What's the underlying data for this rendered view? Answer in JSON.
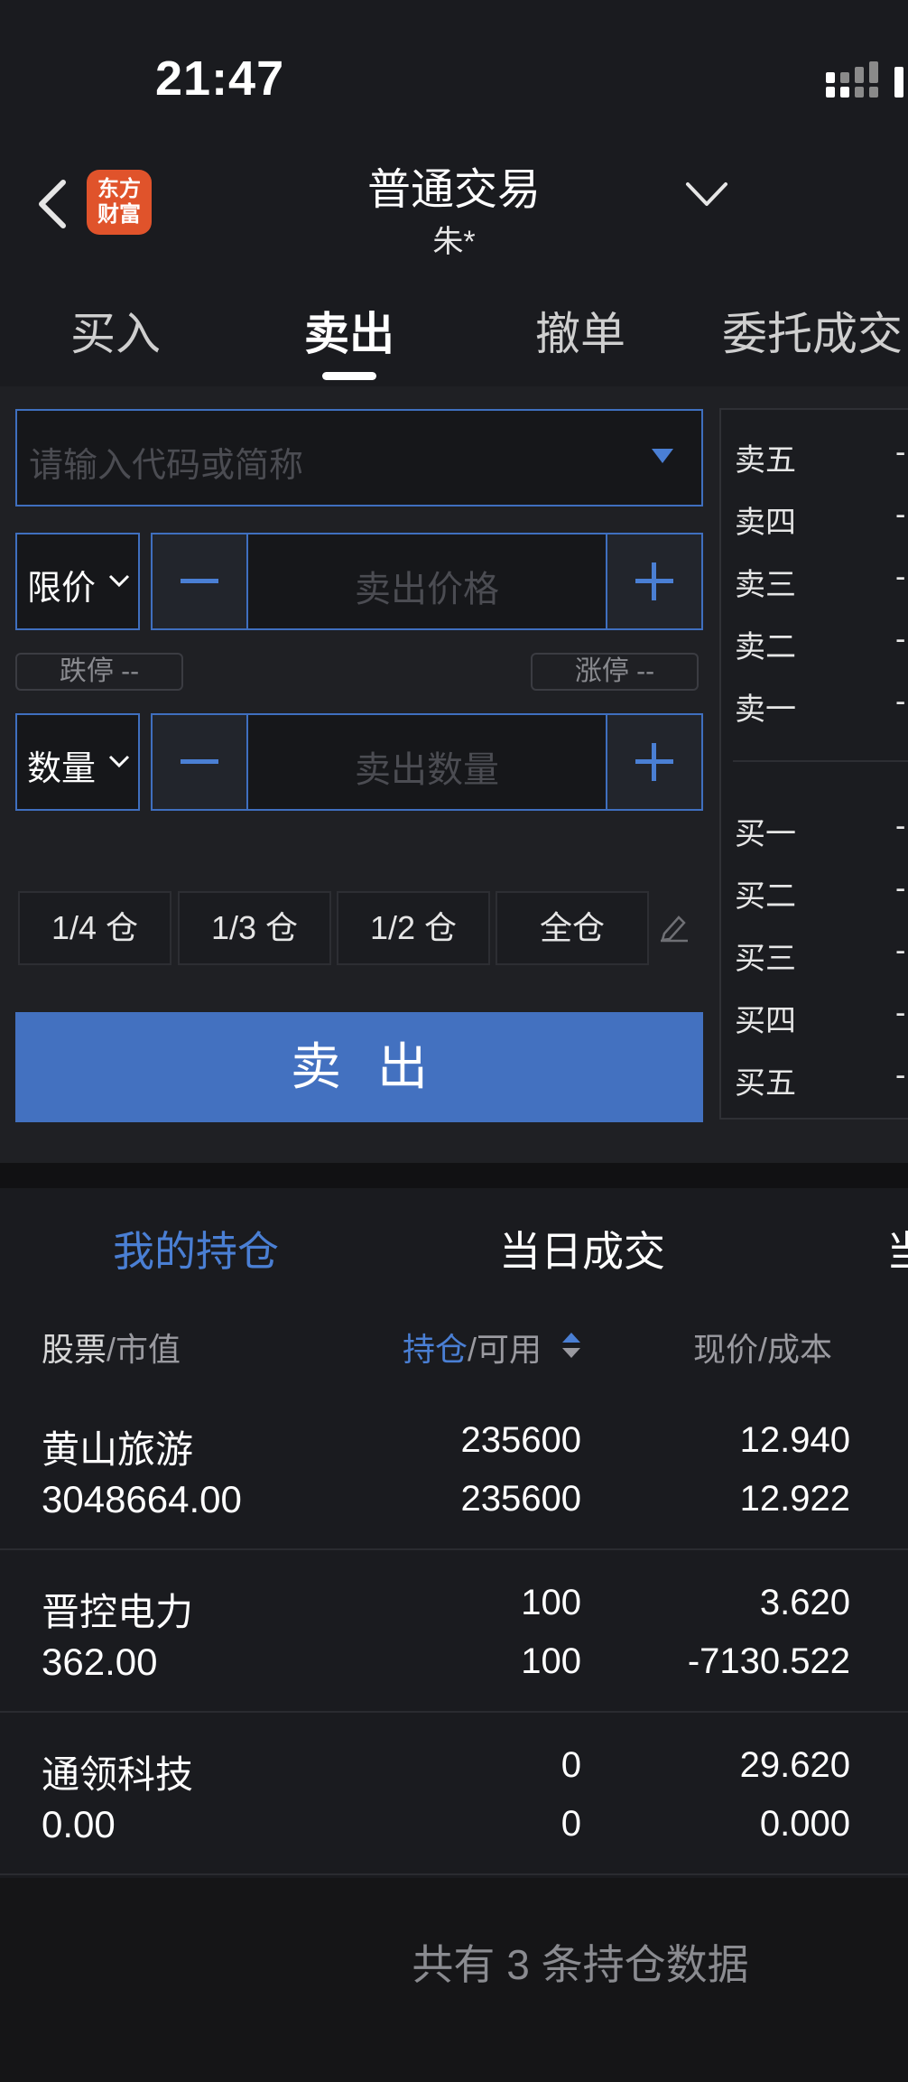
{
  "status_bar": {
    "time": "21:47"
  },
  "header": {
    "title": "普通交易",
    "account": "朱*",
    "logo_line1": "东方",
    "logo_line2": "财富"
  },
  "tabs": [
    {
      "label": "买入"
    },
    {
      "label": "卖出"
    },
    {
      "label": "撤单"
    },
    {
      "label": "委托成交"
    }
  ],
  "active_tab": "卖出",
  "form": {
    "code_placeholder": "请输入代码或简称",
    "price_type": "限价",
    "price_placeholder": "卖出价格",
    "limit_down": "跌停 --",
    "limit_up": "涨停 --",
    "qty_type": "数量",
    "qty_placeholder": "卖出数量",
    "fractions": [
      "1/4 仓",
      "1/3 仓",
      "1/2 仓",
      "全仓"
    ],
    "sell_button": "卖出"
  },
  "order_book": {
    "asks": [
      "卖五",
      "卖四",
      "卖三",
      "卖二",
      "卖一"
    ],
    "bids": [
      "买一",
      "买二",
      "买三",
      "买四",
      "买五"
    ],
    "placeholder": "-"
  },
  "holdings": {
    "tabs": [
      "我的持仓",
      "当日成交",
      "当"
    ],
    "columns": {
      "stock": "股票",
      "market_value": "市值",
      "position": "持仓",
      "available": "可用",
      "price": "现价",
      "cost": "成本",
      "sep": "/"
    },
    "rows": [
      {
        "name": "黄山旅游",
        "value": "3048664.00",
        "position": "235600",
        "available": "235600",
        "price": "12.940",
        "cost": "12.922"
      },
      {
        "name": "晋控电力",
        "value": "362.00",
        "position": "100",
        "available": "100",
        "price": "3.620",
        "cost": "-7130.522"
      },
      {
        "name": "通领科技",
        "value": "0.00",
        "position": "0",
        "available": "0",
        "price": "29.620",
        "cost": "0.000"
      }
    ],
    "footer": "共有 3 条持仓数据"
  },
  "colors": {
    "accent": "#4371c0",
    "accent_text": "#4a7fd4",
    "logo": "#e0532b"
  }
}
